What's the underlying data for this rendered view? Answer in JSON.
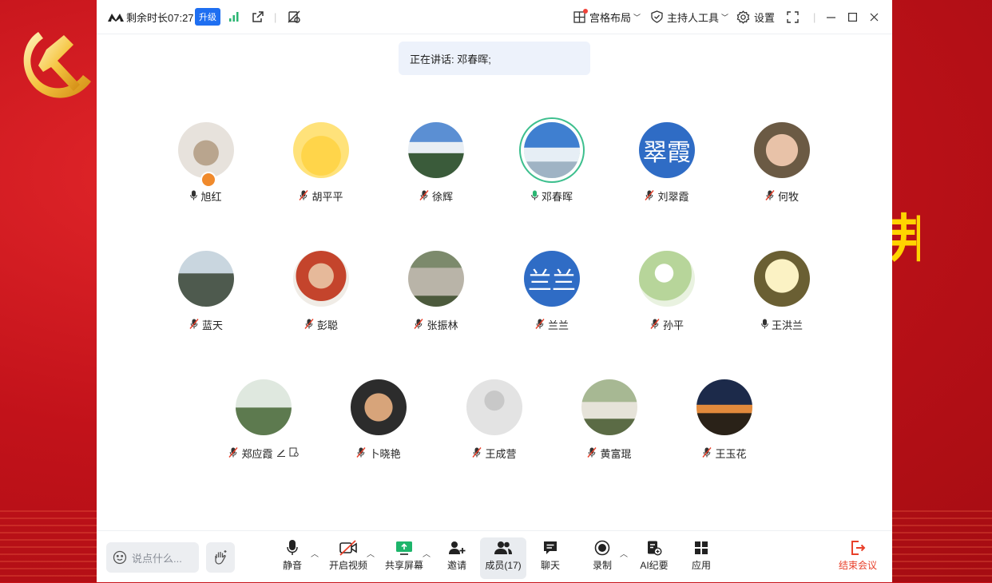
{
  "titlebar": {
    "remaining_time": "剩余时长07:27",
    "upgrade": "升级",
    "layout": "宫格布局",
    "host_tools": "主持人工具",
    "settings": "设置"
  },
  "speaking_banner": "正在讲话: 邓春晖;",
  "side_char": "邦",
  "participants": [
    {
      "name": "旭红",
      "mic": "on"
    },
    {
      "name": "胡平平",
      "mic": "muted"
    },
    {
      "name": "徐辉",
      "mic": "muted"
    },
    {
      "name": "邓春晖",
      "mic": "speaking"
    },
    {
      "name": "刘翠霞",
      "mic": "muted",
      "avatar_text": "翠霞"
    },
    {
      "name": "何牧",
      "mic": "muted"
    },
    {
      "name": "蓝天",
      "mic": "muted"
    },
    {
      "name": "彭聪",
      "mic": "muted"
    },
    {
      "name": "张振林",
      "mic": "muted"
    },
    {
      "name": "兰兰",
      "mic": "muted",
      "avatar_text": "兰兰"
    },
    {
      "name": "孙平",
      "mic": "muted"
    },
    {
      "name": "王洪兰",
      "mic": "on"
    },
    {
      "name": "郑应霞",
      "mic": "muted"
    },
    {
      "name": "卜晓艳",
      "mic": "muted"
    },
    {
      "name": "王成营",
      "mic": "muted"
    },
    {
      "name": "黄富琨",
      "mic": "muted"
    },
    {
      "name": "王玉花",
      "mic": "muted"
    }
  ],
  "toolbar": {
    "chat_placeholder": "说点什么...",
    "mute": "静音",
    "video": "开启视频",
    "share": "共享屏幕",
    "invite": "邀请",
    "members": "成员(17)",
    "chat": "聊天",
    "record": "录制",
    "ai_notes": "AI纪要",
    "apps": "应用",
    "end": "结束会议"
  },
  "colors": {
    "accent": "#1f6ff1",
    "speaking_ring": "#3dbf8e",
    "end": "#e8402a",
    "text_avatar": "#2f6cc5"
  }
}
